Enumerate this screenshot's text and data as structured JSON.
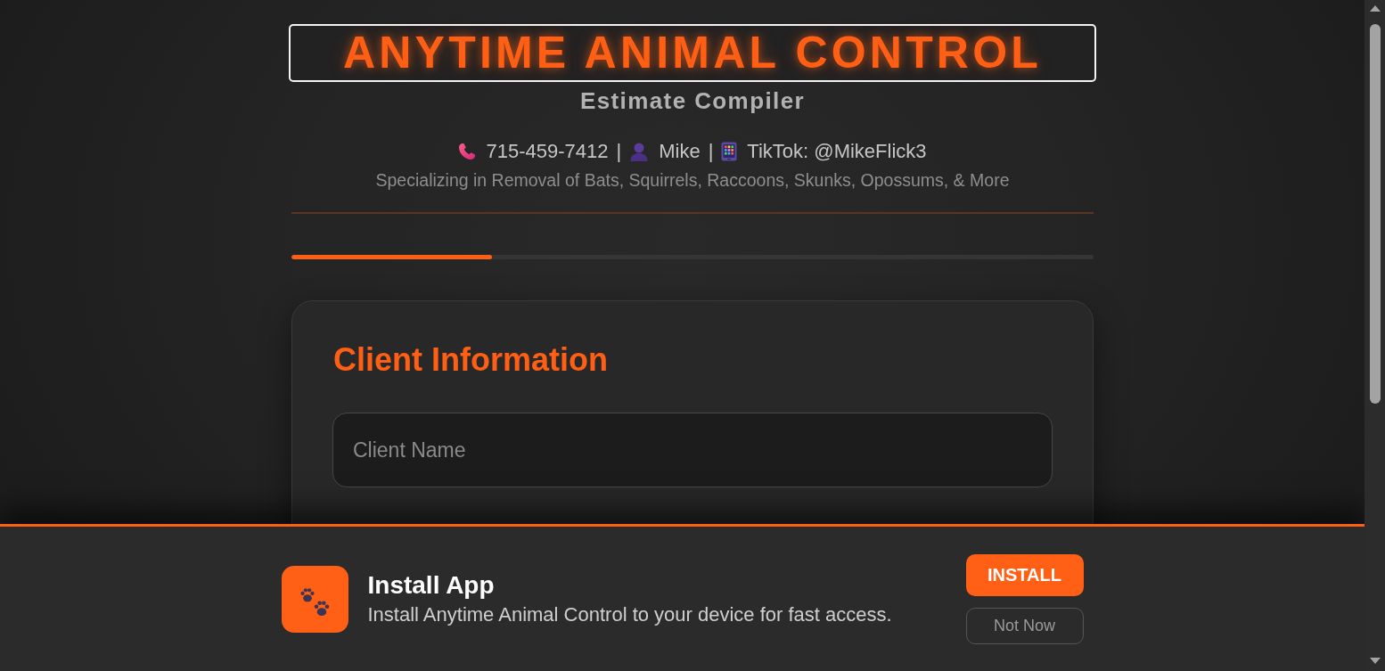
{
  "header": {
    "title": "ANYTIME ANIMAL CONTROL",
    "subtitle": "Estimate Compiler",
    "contact": [
      {
        "kind": "phone",
        "text": "715-459-7412",
        "separator": "|"
      },
      {
        "kind": "person",
        "text": "Mike",
        "separator": "|"
      },
      {
        "kind": "social",
        "text": "TikTok: @MikeFlick3"
      }
    ],
    "tagline": "Specializing in Removal of Bats, Squirrels, Raccoons, Skunks, Opossums, & More"
  },
  "progress": {
    "level": 0.25
  },
  "card": {
    "heading": "Client Information",
    "fields": [
      {
        "placeholder": "Client Name"
      }
    ]
  },
  "install_banner": {
    "title": "Install App",
    "description": "Install Anytime Animal Control to your device for fast access.",
    "buttons": [
      {
        "kind": "primary",
        "label": "INSTALL"
      },
      {
        "kind": "secondary",
        "label": "Not Now"
      }
    ]
  }
}
